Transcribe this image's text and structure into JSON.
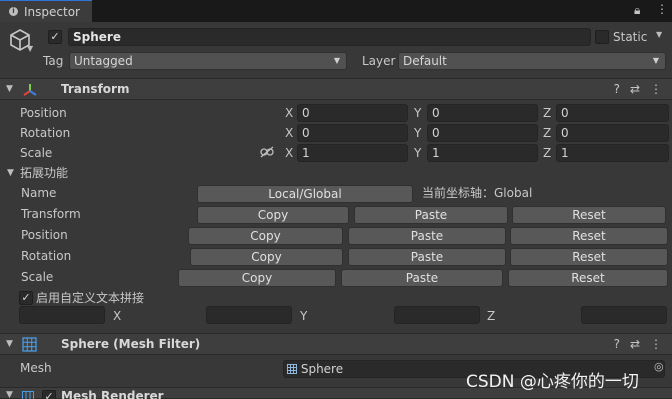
{
  "tab": {
    "title": "Inspector"
  },
  "object": {
    "active": true,
    "name": "Sphere",
    "static_label": "Static",
    "static_checked": false
  },
  "tag": {
    "label": "Tag",
    "value": "Untagged"
  },
  "layer": {
    "label": "Layer",
    "value": "Default"
  },
  "transform": {
    "title": "Transform",
    "rows": [
      {
        "label": "Position",
        "x": "0",
        "y": "0",
        "z": "0"
      },
      {
        "label": "Rotation",
        "x": "0",
        "y": "0",
        "z": "0"
      },
      {
        "label": "Scale",
        "x": "1",
        "y": "1",
        "z": "1"
      }
    ],
    "axis": {
      "x": "X",
      "y": "Y",
      "z": "Z"
    }
  },
  "ext": {
    "title": "拓展功能",
    "name_label": "Name",
    "local_global_button": "Local/Global",
    "coord_text": "当前坐标轴：Global",
    "rows": [
      {
        "label": "Transform",
        "copy": "Copy",
        "paste": "Paste",
        "reset": "Reset"
      },
      {
        "label": "Position",
        "copy": "Copy",
        "paste": "Paste",
        "reset": "Reset"
      },
      {
        "label": "Rotation",
        "copy": "Copy",
        "paste": "Paste",
        "reset": "Reset"
      },
      {
        "label": "Scale",
        "copy": "Copy",
        "paste": "Paste",
        "reset": "Reset"
      }
    ],
    "custom_text_label": "启用自定义文本拼接",
    "custom_text_checked": true,
    "x": "X",
    "y": "Y",
    "z": "Z"
  },
  "mesh_filter": {
    "title": "Sphere (Mesh Filter)",
    "mesh_label": "Mesh",
    "mesh_value": "Sphere"
  },
  "mesh_renderer": {
    "title": "Mesh Renderer"
  },
  "watermark": "CSDN @心疼你的一切",
  "colors": {
    "accent": "#2f76d8",
    "background": "#383838",
    "header": "#3e3e3e",
    "field": "#2a2a2a",
    "button": "#585858"
  }
}
